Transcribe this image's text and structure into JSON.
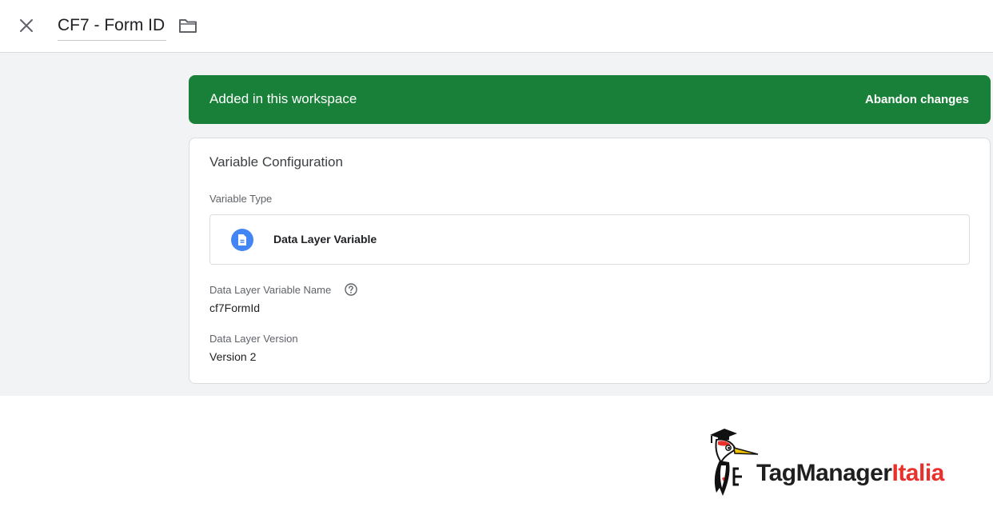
{
  "header": {
    "title": "CF7 - Form ID",
    "close_icon": "close-icon",
    "folder_icon": "folder-icon"
  },
  "banner": {
    "status_text": "Added in this workspace",
    "abandon_label": "Abandon changes",
    "color": "#188038"
  },
  "variable_configuration": {
    "title": "Variable Configuration",
    "type_label": "Variable Type",
    "type_value": "Data Layer Variable",
    "type_icon": "document-icon",
    "name_label": "Data Layer Variable Name",
    "help_icon": "help-icon",
    "name_value": "cf7FormId",
    "version_label": "Data Layer Version",
    "version_value": "Version 2"
  },
  "logo": {
    "text_main": "TagManager",
    "text_accent": "Italia",
    "accent_color": "#e8312c"
  }
}
